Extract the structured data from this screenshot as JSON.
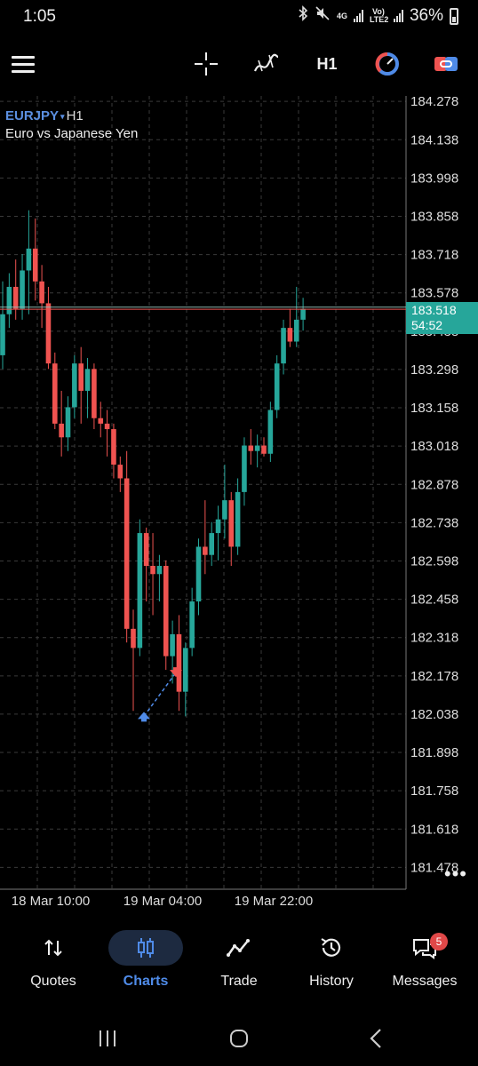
{
  "status_bar": {
    "time": "1:05",
    "net_4g": "4G",
    "net_volte": "Vo) LTE2",
    "battery": "36%"
  },
  "toolbar": {
    "timeframe": "H1",
    "icons": [
      "menu-icon",
      "crosshair-icon",
      "indicators-icon",
      "one-click-trading-icon",
      "trade-icon"
    ]
  },
  "chart": {
    "symbol": "EURJPY",
    "symbol_arrow": "▾",
    "timeframe": "H1",
    "description": "Euro vs Japanese Yen",
    "bid_price": "183.518",
    "countdown": "54:52",
    "more_label": "•••",
    "colors": {
      "bull": "#26a69a",
      "bear": "#ef5350",
      "grid": "#3a3a3a",
      "bid_line": "#ef5350",
      "ask_line": "#8fb8b0"
    }
  },
  "chart_data": {
    "type": "candlestick",
    "y_tick_labels": [
      "184.278",
      "184.138",
      "183.998",
      "183.858",
      "183.718",
      "183.578",
      "183.438",
      "183.298",
      "183.158",
      "183.018",
      "182.878",
      "182.738",
      "182.598",
      "182.458",
      "182.318",
      "182.178",
      "182.038",
      "181.898",
      "181.758",
      "181.618",
      "181.478"
    ],
    "x_tick_labels": [
      "18 Mar 10:00",
      "19 Mar 04:00",
      "19 Mar 22:00"
    ],
    "ylim": [
      181.398,
      184.298
    ],
    "current_price": 183.518,
    "ask_price": 183.526,
    "candles": [
      {
        "o": 183.35,
        "h": 183.62,
        "l": 183.3,
        "c": 183.5
      },
      {
        "o": 183.5,
        "h": 183.65,
        "l": 183.45,
        "c": 183.6
      },
      {
        "o": 183.6,
        "h": 183.7,
        "l": 183.48,
        "c": 183.52
      },
      {
        "o": 183.52,
        "h": 183.72,
        "l": 183.48,
        "c": 183.66
      },
      {
        "o": 183.66,
        "h": 183.88,
        "l": 183.5,
        "c": 183.74
      },
      {
        "o": 183.74,
        "h": 183.85,
        "l": 183.55,
        "c": 183.62
      },
      {
        "o": 183.62,
        "h": 183.68,
        "l": 183.45,
        "c": 183.54
      },
      {
        "o": 183.54,
        "h": 183.6,
        "l": 183.3,
        "c": 183.32
      },
      {
        "o": 183.32,
        "h": 183.36,
        "l": 183.08,
        "c": 183.1
      },
      {
        "o": 183.1,
        "h": 183.22,
        "l": 182.98,
        "c": 183.05
      },
      {
        "o": 183.05,
        "h": 183.2,
        "l": 183.0,
        "c": 183.16
      },
      {
        "o": 183.16,
        "h": 183.35,
        "l": 183.12,
        "c": 183.32
      },
      {
        "o": 183.32,
        "h": 183.38,
        "l": 183.1,
        "c": 183.22
      },
      {
        "o": 183.22,
        "h": 183.34,
        "l": 183.12,
        "c": 183.3
      },
      {
        "o": 183.3,
        "h": 183.32,
        "l": 183.08,
        "c": 183.12
      },
      {
        "o": 183.12,
        "h": 183.18,
        "l": 183.05,
        "c": 183.1
      },
      {
        "o": 183.1,
        "h": 183.15,
        "l": 182.98,
        "c": 183.08
      },
      {
        "o": 183.08,
        "h": 183.1,
        "l": 182.9,
        "c": 182.95
      },
      {
        "o": 182.95,
        "h": 182.98,
        "l": 182.85,
        "c": 182.9
      },
      {
        "o": 182.9,
        "h": 183.0,
        "l": 182.3,
        "c": 182.35
      },
      {
        "o": 182.35,
        "h": 182.42,
        "l": 182.05,
        "c": 182.28
      },
      {
        "o": 182.28,
        "h": 182.75,
        "l": 182.25,
        "c": 182.7
      },
      {
        "o": 182.7,
        "h": 182.72,
        "l": 182.45,
        "c": 182.58
      },
      {
        "o": 182.58,
        "h": 182.7,
        "l": 182.4,
        "c": 182.55
      },
      {
        "o": 182.55,
        "h": 182.62,
        "l": 182.45,
        "c": 182.58
      },
      {
        "o": 182.58,
        "h": 182.6,
        "l": 182.2,
        "c": 182.25
      },
      {
        "o": 182.25,
        "h": 182.38,
        "l": 182.15,
        "c": 182.33
      },
      {
        "o": 182.33,
        "h": 182.4,
        "l": 182.05,
        "c": 182.12
      },
      {
        "o": 182.12,
        "h": 182.3,
        "l": 182.03,
        "c": 182.28
      },
      {
        "o": 182.28,
        "h": 182.5,
        "l": 182.25,
        "c": 182.45
      },
      {
        "o": 182.45,
        "h": 182.68,
        "l": 182.4,
        "c": 182.65
      },
      {
        "o": 182.65,
        "h": 182.82,
        "l": 182.55,
        "c": 182.62
      },
      {
        "o": 182.62,
        "h": 182.74,
        "l": 182.58,
        "c": 182.7
      },
      {
        "o": 182.7,
        "h": 182.8,
        "l": 182.6,
        "c": 182.75
      },
      {
        "o": 182.75,
        "h": 182.95,
        "l": 182.68,
        "c": 182.82
      },
      {
        "o": 182.82,
        "h": 182.85,
        "l": 182.58,
        "c": 182.65
      },
      {
        "o": 182.65,
        "h": 182.9,
        "l": 182.62,
        "c": 182.85
      },
      {
        "o": 182.85,
        "h": 183.05,
        "l": 182.8,
        "c": 183.02
      },
      {
        "o": 183.02,
        "h": 183.08,
        "l": 182.95,
        "c": 183.0
      },
      {
        "o": 183.0,
        "h": 183.06,
        "l": 182.94,
        "c": 183.02
      },
      {
        "o": 183.02,
        "h": 183.05,
        "l": 182.98,
        "c": 182.99
      },
      {
        "o": 182.99,
        "h": 183.18,
        "l": 182.96,
        "c": 183.15
      },
      {
        "o": 183.15,
        "h": 183.35,
        "l": 183.12,
        "c": 183.32
      },
      {
        "o": 183.32,
        "h": 183.48,
        "l": 183.28,
        "c": 183.45
      },
      {
        "o": 183.45,
        "h": 183.52,
        "l": 183.38,
        "c": 183.4
      },
      {
        "o": 183.4,
        "h": 183.6,
        "l": 183.38,
        "c": 183.48
      },
      {
        "o": 183.48,
        "h": 183.56,
        "l": 183.44,
        "c": 183.52
      }
    ],
    "trades": [
      {
        "type": "buy",
        "price": 182.03
      },
      {
        "type": "sell",
        "price": 182.19
      }
    ]
  },
  "bottom_nav": {
    "items": [
      {
        "label": "Quotes",
        "icon": "quotes-icon"
      },
      {
        "label": "Charts",
        "icon": "charts-icon"
      },
      {
        "label": "Trade",
        "icon": "trade-icon"
      },
      {
        "label": "History",
        "icon": "history-icon"
      },
      {
        "label": "Messages",
        "icon": "messages-icon"
      }
    ],
    "active": "Charts",
    "messages_badge": "5"
  }
}
